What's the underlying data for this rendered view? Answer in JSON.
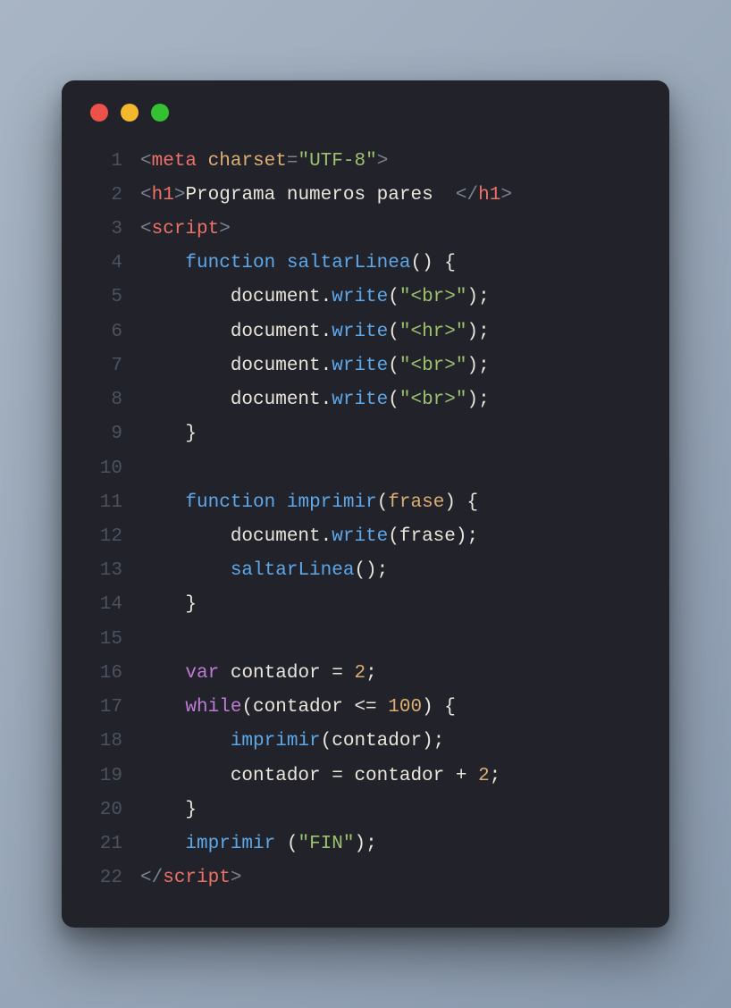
{
  "lines": [
    {
      "n": "1",
      "tokens": [
        [
          "pun",
          "<"
        ],
        [
          "tag",
          "meta"
        ],
        [
          "var",
          " "
        ],
        [
          "attr",
          "charset"
        ],
        [
          "pun",
          "="
        ],
        [
          "str",
          "\"UTF-8\""
        ],
        [
          "pun",
          ">"
        ]
      ]
    },
    {
      "n": "2",
      "tokens": [
        [
          "pun",
          "<"
        ],
        [
          "tag",
          "h1"
        ],
        [
          "pun",
          ">"
        ],
        [
          "var",
          "Programa numeros pares  "
        ],
        [
          "pun",
          "</"
        ],
        [
          "tag",
          "h1"
        ],
        [
          "pun",
          ">"
        ]
      ]
    },
    {
      "n": "3",
      "tokens": [
        [
          "pun",
          "<"
        ],
        [
          "tag",
          "script"
        ],
        [
          "pun",
          ">"
        ]
      ]
    },
    {
      "n": "4",
      "tokens": [
        [
          "var",
          "    "
        ],
        [
          "kw2",
          "function"
        ],
        [
          "var",
          " "
        ],
        [
          "fn",
          "saltarLinea"
        ],
        [
          "var",
          "() {"
        ]
      ]
    },
    {
      "n": "5",
      "tokens": [
        [
          "var",
          "        document."
        ],
        [
          "fn",
          "write"
        ],
        [
          "var",
          "("
        ],
        [
          "str",
          "\"<br>\""
        ],
        [
          "var",
          ");"
        ]
      ]
    },
    {
      "n": "6",
      "tokens": [
        [
          "var",
          "        document."
        ],
        [
          "fn",
          "write"
        ],
        [
          "var",
          "("
        ],
        [
          "str",
          "\"<hr>\""
        ],
        [
          "var",
          ");"
        ]
      ]
    },
    {
      "n": "7",
      "tokens": [
        [
          "var",
          "        document."
        ],
        [
          "fn",
          "write"
        ],
        [
          "var",
          "("
        ],
        [
          "str",
          "\"<br>\""
        ],
        [
          "var",
          ");"
        ]
      ]
    },
    {
      "n": "8",
      "tokens": [
        [
          "var",
          "        document."
        ],
        [
          "fn",
          "write"
        ],
        [
          "var",
          "("
        ],
        [
          "str",
          "\"<br>\""
        ],
        [
          "var",
          ");"
        ]
      ]
    },
    {
      "n": "9",
      "tokens": [
        [
          "var",
          "    }"
        ]
      ]
    },
    {
      "n": "10",
      "tokens": [
        [
          "var",
          ""
        ]
      ]
    },
    {
      "n": "11",
      "tokens": [
        [
          "var",
          "    "
        ],
        [
          "kw2",
          "function"
        ],
        [
          "var",
          " "
        ],
        [
          "fn",
          "imprimir"
        ],
        [
          "var",
          "("
        ],
        [
          "attr",
          "frase"
        ],
        [
          "var",
          ") {"
        ]
      ]
    },
    {
      "n": "12",
      "tokens": [
        [
          "var",
          "        document."
        ],
        [
          "fn",
          "write"
        ],
        [
          "var",
          "(frase);"
        ]
      ]
    },
    {
      "n": "13",
      "tokens": [
        [
          "var",
          "        "
        ],
        [
          "fn",
          "saltarLinea"
        ],
        [
          "var",
          "();"
        ]
      ]
    },
    {
      "n": "14",
      "tokens": [
        [
          "var",
          "    }"
        ]
      ]
    },
    {
      "n": "15",
      "tokens": [
        [
          "var",
          ""
        ]
      ]
    },
    {
      "n": "16",
      "tokens": [
        [
          "var",
          "    "
        ],
        [
          "kw",
          "var"
        ],
        [
          "var",
          " contador = "
        ],
        [
          "num",
          "2"
        ],
        [
          "var",
          ";"
        ]
      ]
    },
    {
      "n": "17",
      "tokens": [
        [
          "var",
          "    "
        ],
        [
          "kw",
          "while"
        ],
        [
          "var",
          "(contador <= "
        ],
        [
          "num",
          "100"
        ],
        [
          "var",
          ") {"
        ]
      ]
    },
    {
      "n": "18",
      "tokens": [
        [
          "var",
          "        "
        ],
        [
          "fn",
          "imprimir"
        ],
        [
          "var",
          "(contador);"
        ]
      ]
    },
    {
      "n": "19",
      "tokens": [
        [
          "var",
          "        contador = contador + "
        ],
        [
          "num",
          "2"
        ],
        [
          "var",
          ";"
        ]
      ]
    },
    {
      "n": "20",
      "tokens": [
        [
          "var",
          "    }"
        ]
      ]
    },
    {
      "n": "21",
      "tokens": [
        [
          "var",
          "    "
        ],
        [
          "fn",
          "imprimir"
        ],
        [
          "var",
          " ("
        ],
        [
          "str",
          "\"FIN\""
        ],
        [
          "var",
          ");"
        ]
      ]
    },
    {
      "n": "22",
      "tokens": [
        [
          "pun",
          "</"
        ],
        [
          "tag",
          "script"
        ],
        [
          "pun",
          ">"
        ]
      ]
    }
  ]
}
